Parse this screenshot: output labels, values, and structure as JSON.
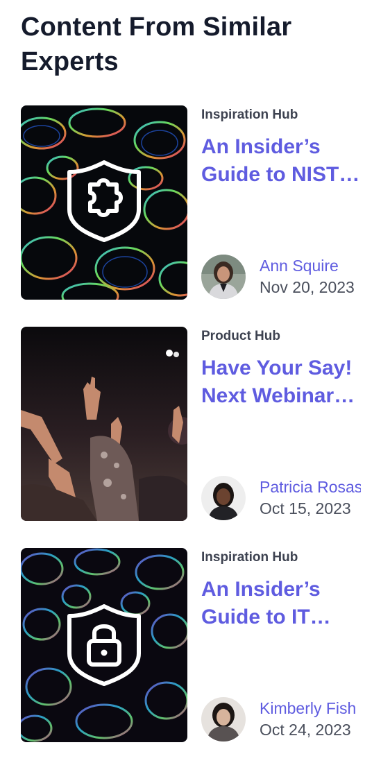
{
  "section": {
    "title": "Content From Similar Experts"
  },
  "cards": [
    {
      "hub": "Inspiration Hub",
      "title": "An Insider’s Guide to NIST Cybersecurity Framework",
      "thumbnail_icon": "shield-puzzle-icon",
      "author": "Ann Squire",
      "date": "Nov 20, 2023"
    },
    {
      "hub": "Product Hub",
      "title": "Have Your Say! Next Webinar Topics",
      "thumbnail_icon": "concert-crowd-photo",
      "author": "Patricia Rosas",
      "date": "Oct 15, 2023"
    },
    {
      "hub": "Inspiration Hub",
      "title": "An Insider’s Guide to IT Security",
      "thumbnail_icon": "shield-lock-icon",
      "author": "Kimberly Fish",
      "date": "Oct 24, 2023"
    }
  ],
  "colors": {
    "title_text": "#151b2c",
    "accent": "#5f5ce0",
    "meta_text": "#4a4f5c"
  }
}
